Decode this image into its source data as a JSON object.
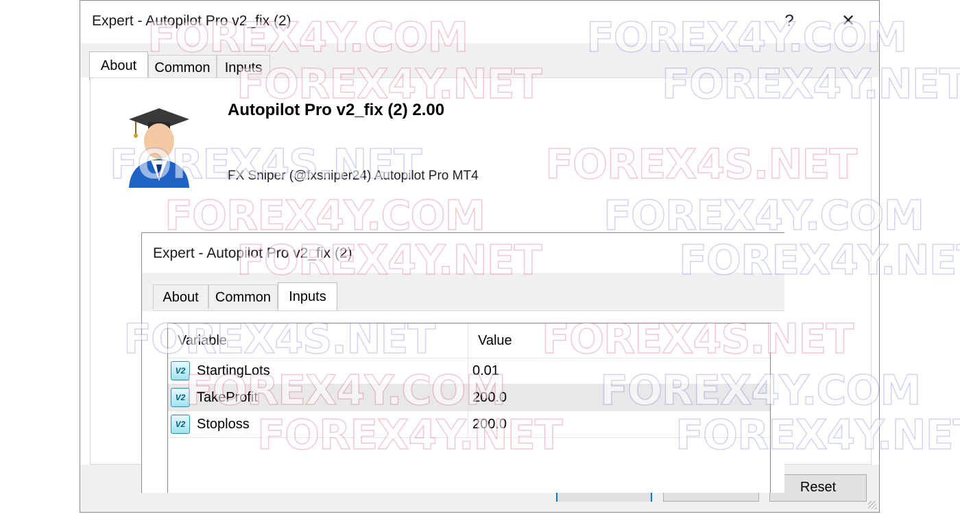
{
  "back_dialog": {
    "title": "Expert - Autopilot Pro v2_fix (2)",
    "help_glyph": "?",
    "close_glyph": "✕",
    "tabs": [
      {
        "label": "About",
        "active": true
      },
      {
        "label": "Common",
        "active": false
      },
      {
        "label": "Inputs",
        "active": false
      }
    ],
    "expert_name": "Autopilot Pro v2_fix (2) 2.00",
    "expert_description": "FX Sniper (@fxsniper24) Autopilot Pro MT4",
    "avatar_icon": "graduate-avatar-icon",
    "reset_label": "Reset"
  },
  "front_dialog": {
    "title": "Expert - Autopilot Pro v2_fix (2)",
    "tabs": [
      {
        "label": "About",
        "active": false
      },
      {
        "label": "Common",
        "active": false
      },
      {
        "label": "Inputs",
        "active": true
      }
    ],
    "columns": [
      "Variable",
      "Value"
    ],
    "rows": [
      {
        "icon": "V2",
        "variable": "StartingLots",
        "value": "0.01",
        "selected": false
      },
      {
        "icon": "V2",
        "variable": "TakeProfit",
        "value": "200.0",
        "selected": true
      },
      {
        "icon": "V2",
        "variable": "Stoploss",
        "value": "200.0",
        "selected": false
      }
    ]
  },
  "watermarks": [
    "FOREX4Y.COM",
    "FOREX4Y.NET",
    "FOREX4S.NET"
  ],
  "colors": {
    "accent": "#0078d7",
    "tab_strip": "#f0f0f0",
    "selected_row": "#e8e8e8"
  }
}
